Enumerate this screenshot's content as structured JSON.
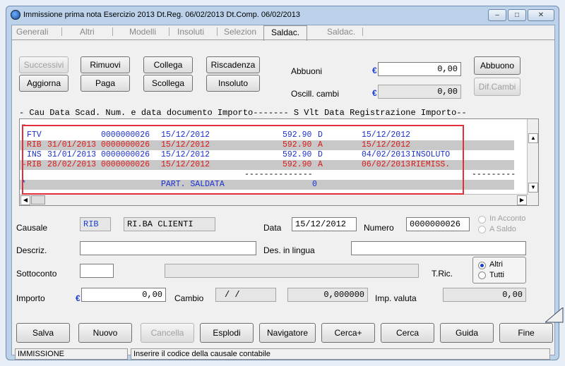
{
  "window": {
    "title": "Immissione prima nota  Esercizio 2013  Dt.Reg. 06/02/2013  Dt.Comp. 06/02/2013",
    "controls": {
      "minimize": "–",
      "maximize": "□",
      "close": "✕"
    }
  },
  "tabs": [
    "Generali",
    "Altri",
    "Modelli",
    "Insoluti",
    "Selezion",
    "Saldac.",
    "Saldac."
  ],
  "active_tab": "Saldac.",
  "toolbar": {
    "successivi": "Successivi",
    "rimuovi": "Rimuovi",
    "collega": "Collega",
    "riscadenza": "Riscadenza",
    "aggiorna": "Aggiorna",
    "paga": "Paga",
    "scollega": "Scollega",
    "insoluto": "Insoluto",
    "abbuono": "Abbuono",
    "dif_cambi": "Dif.Cambi"
  },
  "abbuoni": {
    "label": "Abbuoni",
    "currency": "€",
    "value": "0,00"
  },
  "oscill": {
    "label": "Oscill. cambi",
    "currency": "€",
    "value": "0,00"
  },
  "grid": {
    "header": "- Cau Data Scad. Num. e data documento Importo------- S Vlt Data Registrazione Importo--",
    "rows": [
      {
        "marker": "–",
        "cau": "",
        "scad": "",
        "num": "",
        "data_doc": "",
        "importo": "",
        "segno": "",
        "reg": "",
        "note": "",
        "color": "#000000",
        "alt": false
      },
      {
        "marker": "",
        "cau": "FTV",
        "scad": "",
        "num": "0000000026",
        "data_doc": "15/12/2012",
        "importo": "592.90",
        "segno": "D",
        "reg": "15/12/2012",
        "note": "",
        "color": "#1a2fd0",
        "alt": false
      },
      {
        "marker": "",
        "cau": "RIB",
        "scad": "31/01/2013",
        "num": "0000000026",
        "data_doc": "15/12/2012",
        "importo": "592.90",
        "segno": "A",
        "reg": "15/12/2012",
        "note": "",
        "color": "#d81818",
        "alt": true
      },
      {
        "marker": "",
        "cau": "INS",
        "scad": "31/01/2013",
        "num": "0000000026",
        "data_doc": "15/12/2012",
        "importo": "592.90",
        "segno": "D",
        "reg": "04/02/2013",
        "note": "INSOLUTO",
        "color": "#1a2fd0",
        "alt": false
      },
      {
        "marker": "–",
        "cau": "RIB",
        "scad": "28/02/2013",
        "num": "0000000026",
        "data_doc": "15/12/2012",
        "importo": "592.90",
        "segno": "A",
        "reg": "06/02/2013",
        "note": "RIEMISS.",
        "color": "#d81818",
        "alt": true
      }
    ],
    "separator": "--------------",
    "separator_right": "---------",
    "total_marker": "*",
    "total_label": "PART. SALDATA",
    "total_value": "0"
  },
  "form": {
    "causale_label": "Causale",
    "causale_code": "RIB",
    "causale_desc": "RI.BA CLIENTI",
    "data_label": "Data",
    "data_value": "15/12/2012",
    "numero_label": "Numero",
    "numero_value": "0000000026",
    "in_acconto": "In Acconto",
    "a_saldo": "A Saldo",
    "descriz_label": "Descriz.",
    "descriz_value": "",
    "des_lingua_label": "Des. in lingua",
    "des_lingua_value": "",
    "sottoconto_label": "Sottoconto",
    "sottoconto_value": "",
    "tric_label": "T.Ric.",
    "altri": "Altri",
    "tutti": "Tutti",
    "importo_label": "Importo",
    "importo_currency": "€",
    "importo_value": "0,00",
    "cambio_label": "Cambio",
    "cambio_value": "/  /",
    "cambio_amount": "0,000000",
    "imp_valuta_label": "Imp. valuta",
    "imp_valuta_value": "0,00"
  },
  "bottom_buttons": [
    "Salva",
    "Nuovo",
    "Cancella",
    "Esplodi",
    "Navigatore",
    "Cerca+",
    "Cerca",
    "Guida",
    "Fine"
  ],
  "status": {
    "mode": "IMMISSIONE",
    "message": "Inserire il codice della causale contabile"
  },
  "colors": {
    "blue_text": "#1a2fd0",
    "red_text": "#d81818",
    "highlight": "#e0303c"
  }
}
